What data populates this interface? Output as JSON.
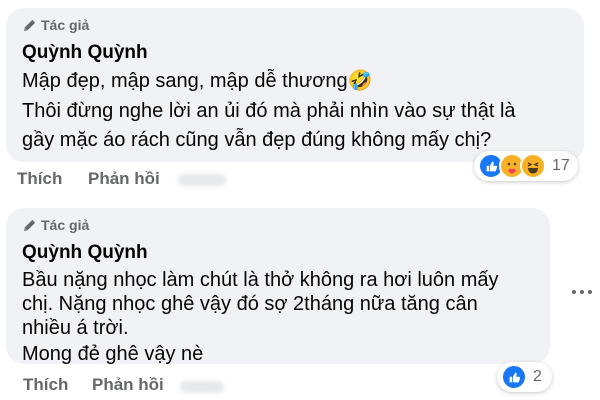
{
  "comments": [
    {
      "badge": "Tác giả",
      "author": "Quỳnh Quỳnh",
      "lines": [
        "Mập đẹp, mập sang, mập dễ thương🤣",
        "Thôi đừng nghe lời an ủi đó mà phải nhìn vào sự thật là",
        "gầy mặc áo rách cũng vẫn đẹp đúng không mấy chị?"
      ],
      "actions": {
        "like": "Thích",
        "reply": "Phản hồi"
      },
      "reactions": {
        "icons": [
          "like-icon",
          "care-icon",
          "haha-icon"
        ],
        "count": "17"
      }
    },
    {
      "badge": "Tác giả",
      "author": "Quỳnh Quỳnh",
      "lines": [
        "Bầu nặng nhọc làm chút là thở không ra hơi luôn mấy",
        "chị. Nặng nhọc ghê vậy đó sợ 2tháng nữa tăng cân",
        "nhiều á trời.",
        "Mong đẻ ghê vậy nè"
      ],
      "actions": {
        "like": "Thích",
        "reply": "Phản hồi"
      },
      "reactions": {
        "icons": [
          "like-icon"
        ],
        "count": "2"
      }
    }
  ],
  "colors": {
    "bubble": "#f0f2f5",
    "secondary_text": "#65676b",
    "like_blue": "#1877f2",
    "emoji_yellow": "#f7b125"
  }
}
